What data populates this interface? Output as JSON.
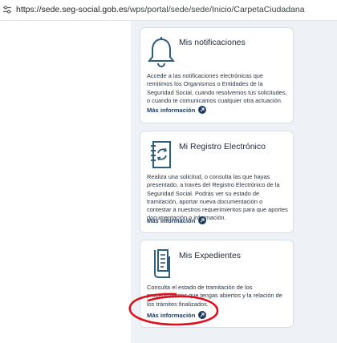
{
  "browser": {
    "url_domain": "https://sede.seg-social.gob.es",
    "url_path": "/wps/portal/sede/sede/Inicio/CarpetaCiudadana"
  },
  "cards": [
    {
      "title": "Mis notificaciones",
      "icon": "bell-icon",
      "description": "Accede a las notificaciones electrónicas que remitimos los Organismos o Entidades de la Seguridad Social, cuando resolvemos tus solicitudes, o cuando te comunicamos cualquier otra actuación.",
      "link": "Más información"
    },
    {
      "title": "Mi Registro Electrónico",
      "icon": "registry-notebook-icon",
      "description": "Realiza una solicitud, o consulta las que hayas presentado, a través del Registro Electrónico de la Seguridad Social. Podrás ver su estado de tramitación, aportar nueva documentación o contestar a nuestros requerimientos para que aportes documentación o información.",
      "link": "Más información"
    },
    {
      "title": "Mis Expedientes",
      "icon": "files-folder-icon",
      "description": "Consulta el estado de tramitación de los procedimientos que tengas abiertos y la relación de los trámites finalizados.",
      "link": "Más información"
    }
  ],
  "colors": {
    "link": "#1e3a5f",
    "icon": "#2f5d7c",
    "panel_bg": "#eef1f5",
    "annotation": "#e0101a"
  }
}
